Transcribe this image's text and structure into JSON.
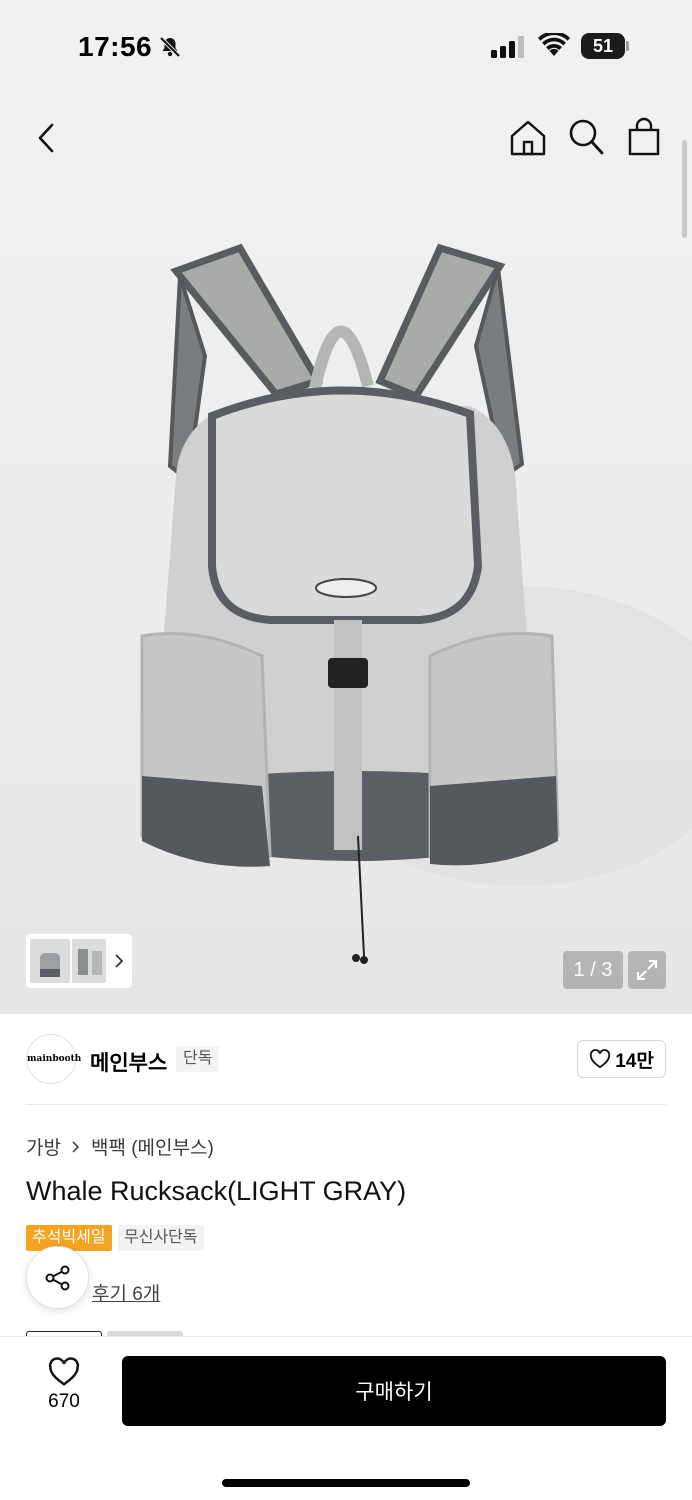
{
  "status_bar": {
    "time": "17:56",
    "battery": "51"
  },
  "gallery": {
    "page_indicator": "1 / 3"
  },
  "brand": {
    "logo_text": "mainbooth",
    "name": "메인부스",
    "badge": "단독",
    "like_count": "14만"
  },
  "product": {
    "breadcrumb": [
      "가방",
      "백팩 (메인부스)"
    ],
    "title": "Whale Rucksack(LIGHT GRAY)",
    "tags": [
      "추석빅세일",
      "무신사단독"
    ],
    "review_link": "후기 6개"
  },
  "bottom_bar": {
    "wish_count": "670",
    "buy_label": "구매하기"
  },
  "colors": {
    "sale_tag": "#f5a320",
    "buy_button": "#000000"
  }
}
